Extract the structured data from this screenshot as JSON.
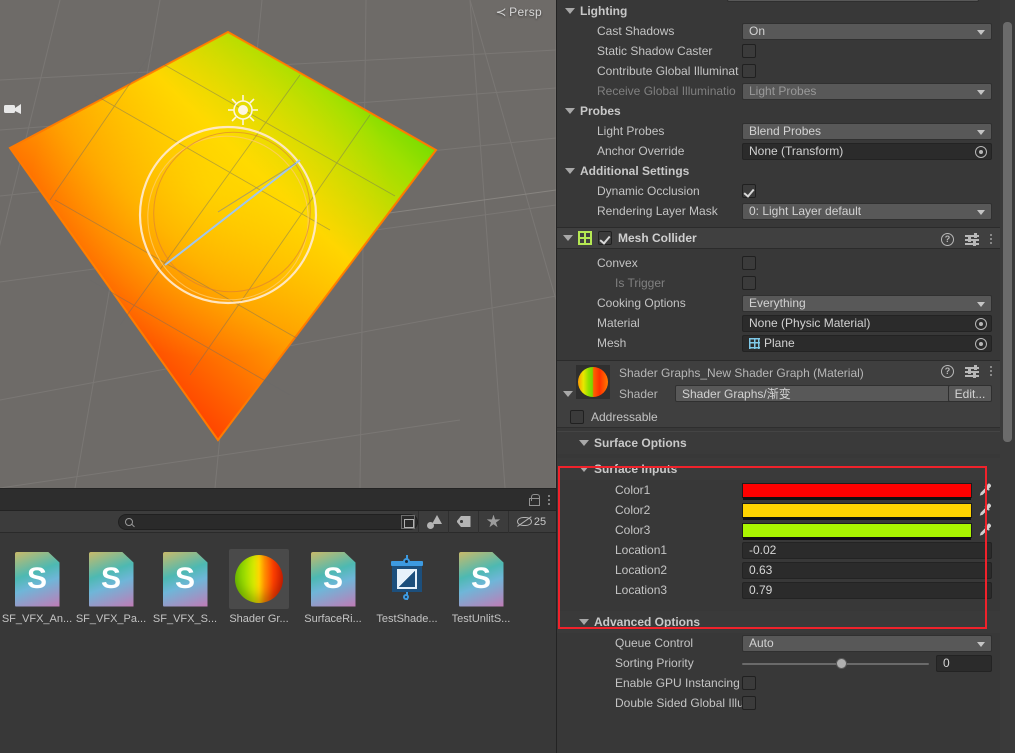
{
  "scene": {
    "view_label": "Persp",
    "gizmo_icon": "camera-gizmo-icon",
    "light_icon": "directional-light-gizmo-icon",
    "background_color": "#6e6b68",
    "plane_gradient": [
      "#ff1100",
      "#ffd400",
      "#22dd00"
    ]
  },
  "project_panel": {
    "lock_icon": "lock-icon",
    "menu_icon": "kebab-menu-icon",
    "search": {
      "value": "",
      "placeholder": "",
      "icon": "search-icon"
    },
    "popout_icon": "search-in-window-icon",
    "filter_icons": [
      "type-filter-icon",
      "label-filter-icon",
      "favorite-star-icon"
    ],
    "hidden_count_icon": "eye-off-icon",
    "hidden_count": "25",
    "assets": [
      {
        "label": "SF_VFX_An...",
        "icon": "shader-graph-file-icon",
        "glyph": "S",
        "selected": false
      },
      {
        "label": "SF_VFX_Pa...",
        "icon": "shader-graph-file-icon",
        "glyph": "S",
        "selected": false
      },
      {
        "label": "SF_VFX_S...",
        "icon": "shader-graph-file-icon",
        "glyph": "S",
        "selected": false
      },
      {
        "label": "Shader Gr...",
        "icon": "material-sphere-icon",
        "glyph": "",
        "selected": true
      },
      {
        "label": "SurfaceRi...",
        "icon": "shader-graph-file-icon",
        "glyph": "S",
        "selected": false
      },
      {
        "label": "TestShade...",
        "icon": "prefab-icon",
        "glyph": "",
        "selected": false
      },
      {
        "label": "TestUnlitS...",
        "icon": "shader-graph-file-icon",
        "glyph": "S",
        "selected": false
      }
    ]
  },
  "inspector": {
    "lighting": {
      "title": "Lighting",
      "rows": [
        {
          "label": "Cast Shadows",
          "type": "dropdown",
          "value": "On",
          "dim": false
        },
        {
          "label": "Static Shadow Caster",
          "type": "checkbox",
          "value": false,
          "dim": false
        },
        {
          "label": "Contribute Global Illuminat",
          "type": "checkbox",
          "value": false,
          "dim": false
        },
        {
          "label": "Receive Global Illuminatio",
          "type": "dropdown",
          "value": "Light Probes",
          "dim": true
        }
      ]
    },
    "probes": {
      "title": "Probes",
      "rows": [
        {
          "label": "Light Probes",
          "type": "dropdown",
          "value": "Blend Probes",
          "dim": false
        },
        {
          "label": "Anchor Override",
          "type": "objectfield",
          "value": "None (Transform)",
          "dim": false
        }
      ]
    },
    "additional_settings": {
      "title": "Additional Settings",
      "rows": [
        {
          "label": "Dynamic Occlusion",
          "type": "checkbox",
          "value": true,
          "dim": false
        },
        {
          "label": "Rendering Layer Mask",
          "type": "dropdown",
          "value": "0: Light Layer default",
          "dim": false
        }
      ]
    },
    "mesh_collider": {
      "title": "Mesh Collider",
      "enabled": true,
      "component_icon": "mesh-collider-icon",
      "help_icon": "help-icon",
      "preset_icon": "preset-icon",
      "menu_icon": "kebab-menu-icon",
      "rows": [
        {
          "label": "Convex",
          "type": "checkbox",
          "value": false,
          "dim": false
        },
        {
          "label": "Is Trigger",
          "type": "checkbox",
          "value": false,
          "dim": true
        },
        {
          "label": "Cooking Options",
          "type": "dropdown",
          "value": "Everything",
          "dim": false
        },
        {
          "label": "Material",
          "type": "objectfield",
          "value": "None (Physic Material)",
          "dim": false
        },
        {
          "label": "Mesh",
          "type": "objectfield",
          "value": "Plane",
          "dim": false,
          "icon": "mesh-icon"
        }
      ]
    },
    "material": {
      "title": "Shader Graphs_New Shader Graph (Material)",
      "preview_icon": "material-sphere-preview",
      "shader_label": "Shader",
      "shader_value": "Shader Graphs/渐变",
      "edit_button": "Edit...",
      "addressable_label": "Addressable",
      "addressable_checked": false,
      "help_icon": "help-icon",
      "preset_icon": "preset-icon",
      "menu_icon": "kebab-menu-icon"
    },
    "surface_options": {
      "title": "Surface Options"
    },
    "surface_inputs": {
      "title": "Surface Inputs",
      "highlighted": true,
      "highlight_color": "#f0222b",
      "rows": [
        {
          "label": "Color1",
          "type": "color",
          "value": "#ff0000",
          "eyedropper": "eyedropper-icon"
        },
        {
          "label": "Color2",
          "type": "color",
          "value": "#ffd400",
          "eyedropper": "eyedropper-icon"
        },
        {
          "label": "Color3",
          "type": "color",
          "value": "#aaf500",
          "eyedropper": "eyedropper-icon"
        },
        {
          "label": "Location1",
          "type": "number",
          "value": "-0.02"
        },
        {
          "label": "Location2",
          "type": "number",
          "value": "0.63"
        },
        {
          "label": "Location3",
          "type": "number",
          "value": "0.79"
        }
      ]
    },
    "advanced_options": {
      "title": "Advanced Options",
      "rows": [
        {
          "label": "Queue Control",
          "type": "dropdown",
          "value": "Auto"
        },
        {
          "label": "Sorting Priority",
          "type": "slider",
          "value": "0"
        },
        {
          "label": "Enable GPU Instancing",
          "type": "checkbox",
          "value": false
        },
        {
          "label": "Double Sided Global Illumi",
          "type": "checkbox",
          "value": false
        }
      ]
    }
  }
}
